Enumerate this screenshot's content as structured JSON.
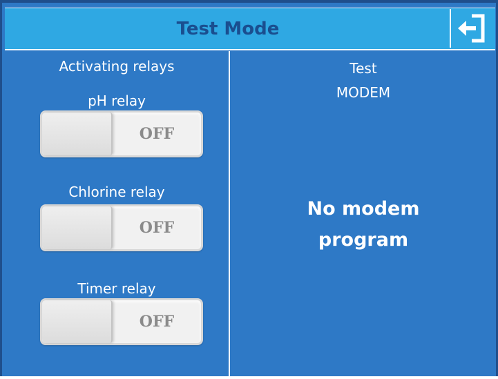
{
  "header": {
    "title": "Test Mode",
    "exit_icon": "exit-arrow-icon"
  },
  "left": {
    "section_title": "Activating relays",
    "relays": [
      {
        "label": "pH relay",
        "state": "OFF"
      },
      {
        "label": "Chlorine relay",
        "state": "OFF"
      },
      {
        "label": "Timer relay",
        "state": "OFF"
      }
    ]
  },
  "right": {
    "line1": "Test",
    "line2": "MODEM",
    "message_line1": "No modem",
    "message_line2": "program"
  },
  "colors": {
    "background": "#2E79C6",
    "header": "#2FA8E3",
    "title": "#1A4E8F"
  }
}
